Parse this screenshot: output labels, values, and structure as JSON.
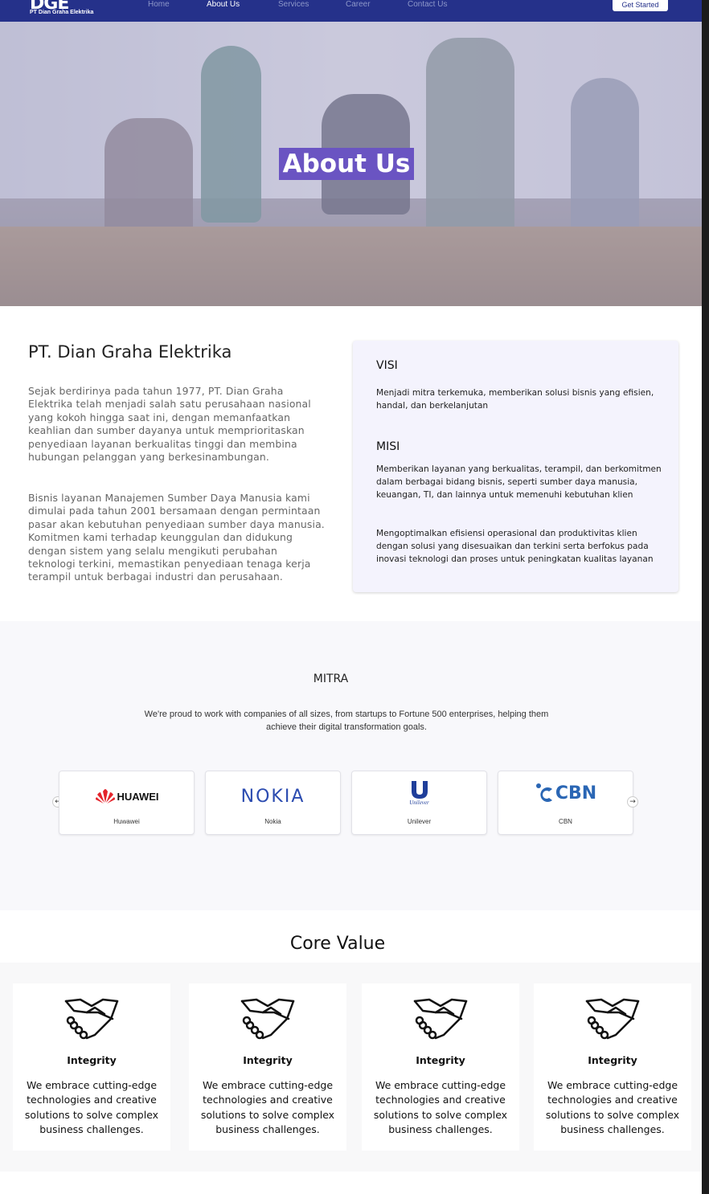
{
  "nav": {
    "logo_mark": "DGE",
    "logo_text": "PT Dian Graha Elektrika",
    "links": [
      "Home",
      "About Us",
      "Services",
      "Career",
      "Contact Us"
    ],
    "active": "About Us",
    "cta": "Get Started"
  },
  "hero": {
    "title": "About Us"
  },
  "about": {
    "heading": "PT. Dian Graha Elektrika",
    "paragraph1": "Sejak berdirinya pada tahun 1977, PT. Dian Graha Elektrika telah menjadi salah satu perusahaan nasional yang kokoh hingga saat ini, dengan memanfaatkan keahlian dan sumber dayanya untuk memprioritaskan penyediaan layanan berkualitas tinggi dan membina hubungan pelanggan yang berkesinambungan.",
    "paragraph2": "Bisnis layanan Manajemen Sumber Daya Manusia kami dimulai pada tahun 2001 bersamaan dengan permintaan pasar akan kebutuhan penyediaan sumber daya manusia. Komitmen kami terhadap keunggulan dan didukung dengan sistem yang selalu mengikuti perubahan teknologi terkini, memastikan penyediaan tenaga kerja terampil untuk berbagai industri dan perusahaan."
  },
  "visi_misi": {
    "visi_title": "VISI",
    "visi_text": "Menjadi mitra terkemuka, memberikan solusi bisnis yang efisien, handal, dan berkelanjutan",
    "misi_title": "MISI",
    "misi_text1": "Memberikan layanan yang berkualitas, terampil, dan berkomitmen dalam berbagai bidang bisnis, seperti sumber daya manusia, keuangan, TI, dan lainnya untuk memenuhi kebutuhan klien",
    "misi_text2": "Mengoptimalkan efisiensi operasional dan produktivitas klien dengan solusi yang disesuaikan dan terkini serta berfokus pada inovasi teknologi dan proses untuk peningkatan kualitas layanan"
  },
  "mitra": {
    "title": "MITRA",
    "subtitle": "We're proud to work with companies of all sizes, from startups to Fortune 500 enterprises, helping them achieve their digital transformation goals.",
    "partners": [
      {
        "logo": "HUAWEI",
        "name": "Huwawei"
      },
      {
        "logo": "NOKIA",
        "name": "Nokia"
      },
      {
        "logo": "Unilever",
        "name": "Unilever"
      },
      {
        "logo": "CBN",
        "name": "CBN"
      }
    ],
    "prev_icon": "arrow-left-icon",
    "next_icon": "arrow-right-icon"
  },
  "core_value": {
    "title": "Core Value",
    "items": [
      {
        "icon": "handshake-icon",
        "name": "Integrity",
        "desc": "We embrace cutting-edge technologies and creative solutions to solve complex business challenges."
      },
      {
        "icon": "handshake-icon",
        "name": "Integrity",
        "desc": "We embrace cutting-edge technologies and creative solutions to solve complex business challenges."
      },
      {
        "icon": "handshake-icon",
        "name": "Integrity",
        "desc": "We embrace cutting-edge technologies and creative solutions to solve complex business challenges."
      },
      {
        "icon": "handshake-icon",
        "name": "Integrity",
        "desc": "We embrace cutting-edge technologies and creative solutions to solve complex business challenges."
      }
    ]
  },
  "colors": {
    "nav_bg": "#25318a",
    "hero_title_bg": "#6a54c2",
    "card_bg": "#f4f3fd",
    "huawei_red": "#e4242b",
    "nokia_blue": "#2b4bb0",
    "cbn_blue": "#2a66b4"
  }
}
